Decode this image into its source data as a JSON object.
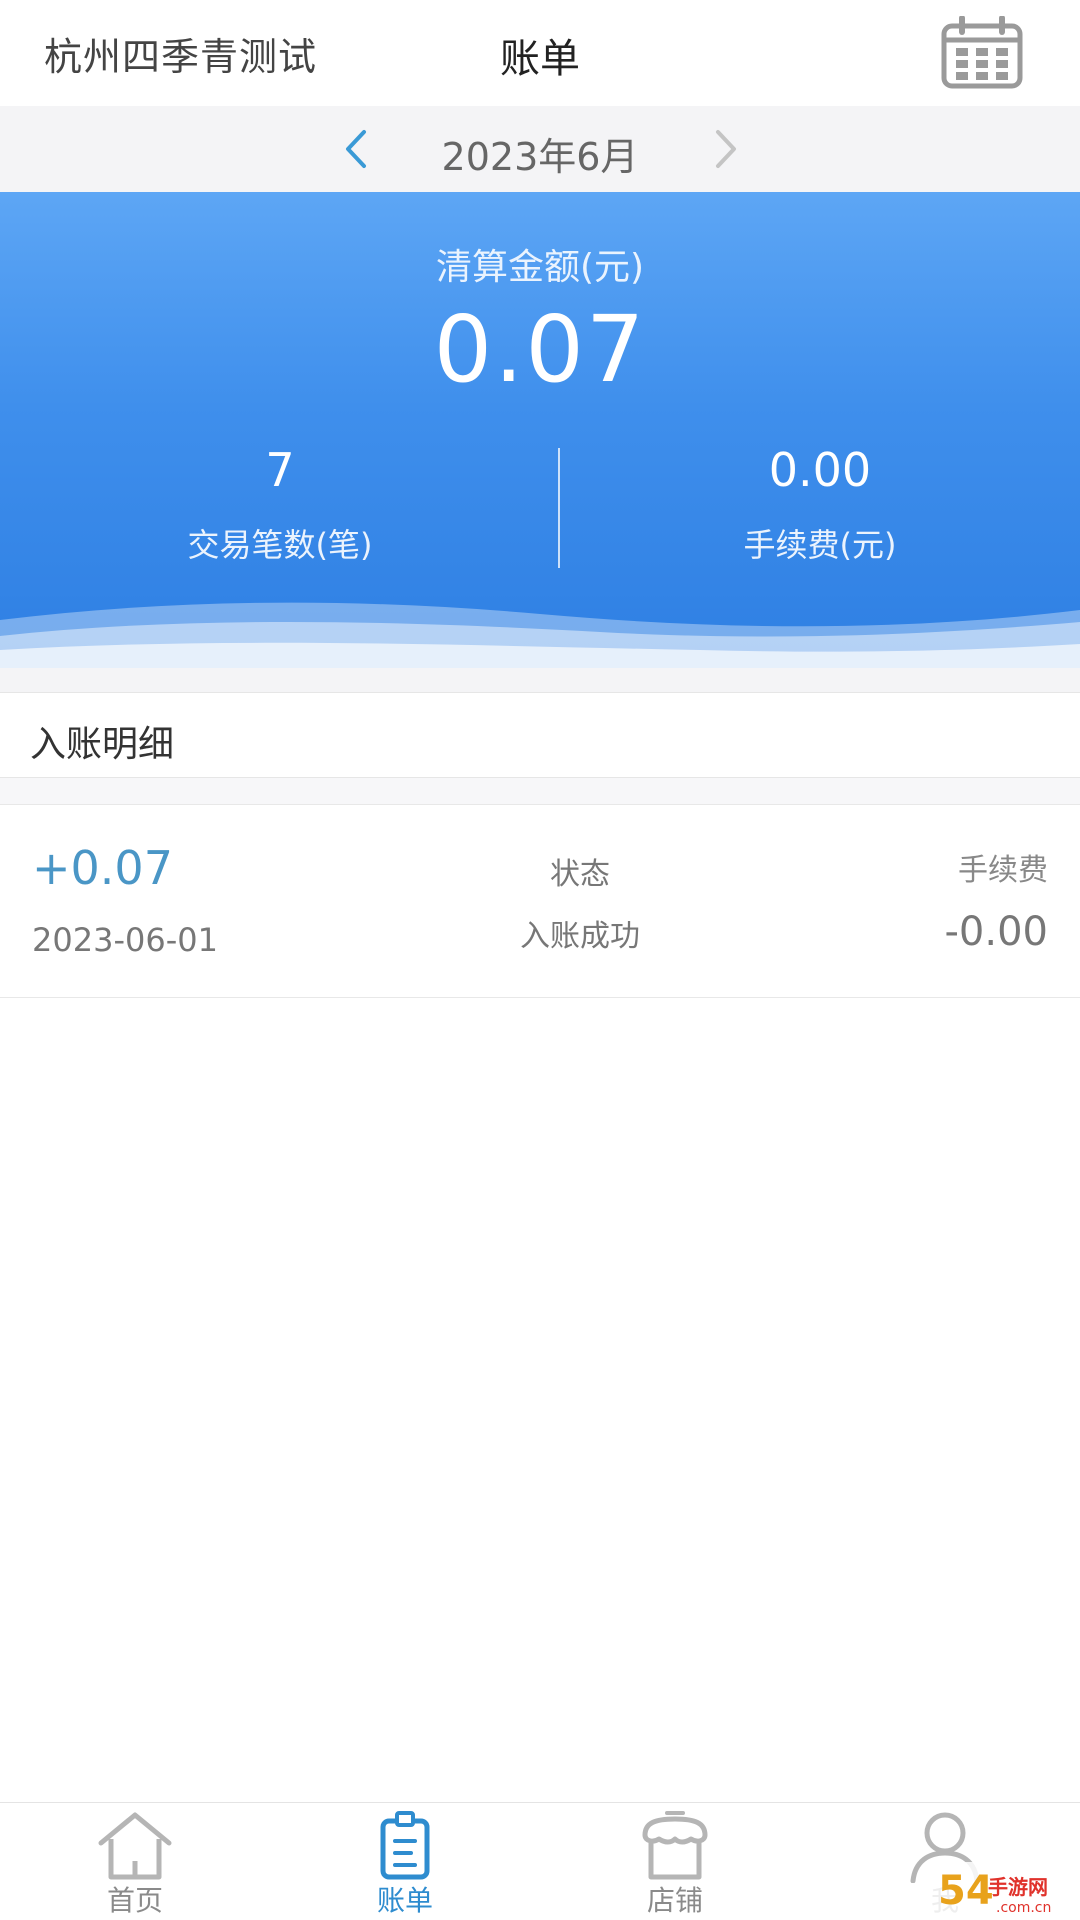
{
  "header": {
    "store_name": "杭州四季青测试",
    "title": "账单",
    "calendar_icon": "calendar-icon"
  },
  "month_bar": {
    "label": "2023年6月",
    "prev_icon": "chevron-left-icon",
    "next_icon": "chevron-right-icon"
  },
  "summary": {
    "settle_label": "清算金额(元)",
    "settle_amount": "0.07",
    "transactions_value": "7",
    "transactions_label": "交易笔数(笔)",
    "fee_value": "0.00",
    "fee_label": "手续费(元)"
  },
  "details": {
    "section_title": "入账明细",
    "records": [
      {
        "amount": "+0.07",
        "date": "2023-06-01",
        "status_label": "状态",
        "status_value": "入账成功",
        "fee_label": "手续费",
        "fee_value": "-0.00"
      }
    ]
  },
  "tabbar": {
    "items": [
      {
        "label": "首页",
        "icon": "home-icon",
        "active": false
      },
      {
        "label": "账单",
        "icon": "bill-icon",
        "active": true
      },
      {
        "label": "店铺",
        "icon": "store-icon",
        "active": false
      },
      {
        "label": "我",
        "icon": "user-icon",
        "active": false
      }
    ]
  },
  "watermark": {
    "text": "54问 手游网 .com.cn"
  },
  "colors": {
    "accent": "#2e8ccf",
    "summary_top": "#5da6f5",
    "summary_bottom": "#2e7fe3",
    "amount_positive": "#4a96c6"
  }
}
